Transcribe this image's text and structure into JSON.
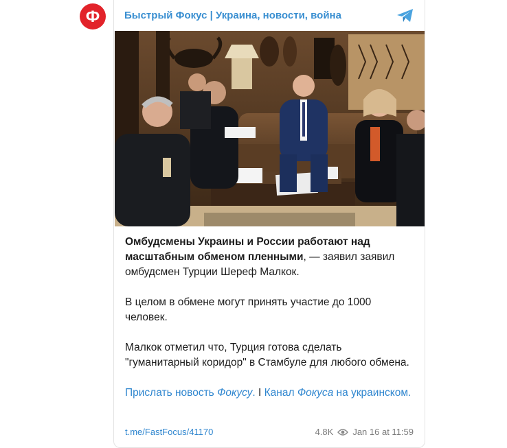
{
  "channel": {
    "title": "Быстрый Фокус | Украина, новости, война",
    "avatar_letter": "Ф",
    "accent": "#3a8fd1",
    "avatar_color": "#e2232a"
  },
  "post": {
    "headline_bold": "Омбудсмены Украины и России работают над масштабным обменом пленными",
    "headline_rest": ", — заявил заявил омбудсмен Турции Шереф Малкок.",
    "para2": "В целом в обмене могут принять участие до 1000 человек.",
    "para3": "Малкок отметил что, Турция готова сделать \"гуманитарный коридор\" в Стамбуле для любого обмена.",
    "links": {
      "send_prefix": "Прислать новость ",
      "send_em": "Фокусу",
      "send_suffix": ".",
      "separator": " I ",
      "channel_prefix": "Канал ",
      "channel_em": "Фокуса",
      "channel_suffix": " на украинском."
    }
  },
  "footer": {
    "url": "t.me/FastFocus/41170",
    "views": "4.8K",
    "date": "Jan 16 at 11:59"
  },
  "icons": {
    "share": "telegram-share-icon",
    "views": "eye-icon"
  }
}
